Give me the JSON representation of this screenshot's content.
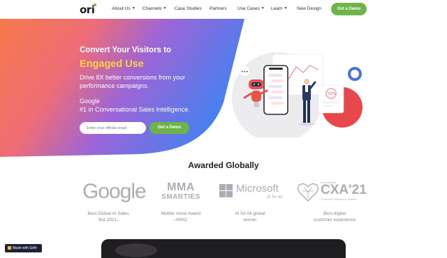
{
  "nav": {
    "logo": "ori",
    "items": [
      {
        "label": "About Us",
        "dropdown": true
      },
      {
        "label": "Channels",
        "dropdown": true
      },
      {
        "label": "Case Studies",
        "dropdown": false
      },
      {
        "label": "Partners",
        "dropdown": false
      },
      {
        "label": "Use Cases",
        "dropdown": true
      },
      {
        "label": "Learn",
        "dropdown": true
      },
      {
        "label": "New Design",
        "dropdown": false
      }
    ],
    "cta_label": "Get a Demo"
  },
  "hero": {
    "title": "Convert Your Visitors to",
    "highlight": "Engaged Use",
    "subtitle": "Drive 8X better conversions from your performance campaigns.",
    "google_line1": "Google",
    "google_line2": "#1 in Conversational Sales Intelligence.",
    "email_placeholder": "Enter your official email",
    "cta_label": "Get a Demo",
    "illustration_percent": "72%"
  },
  "awards": {
    "heading": "Awarded Globally",
    "items": [
      {
        "logo": "Google",
        "caption_lines": [
          "Best Global AI Sales",
          "Bot 2021."
        ]
      },
      {
        "logo_top": "MMA",
        "logo_bottom": "SMARTIES",
        "caption_lines": [
          "Mobile Voice Award",
          "-APAC"
        ]
      },
      {
        "logo": "Microsoft",
        "logo_sub": "AI for all",
        "caption_lines": [
          "AI for All global",
          "winner"
        ]
      },
      {
        "logo": "CXA'21",
        "logo_tag": "International",
        "logo_sub": "Customer Experience Awards",
        "caption_lines": [
          "Best digital",
          "customer experience"
        ]
      }
    ]
  },
  "badge": {
    "label": "Made with Softr"
  },
  "colors": {
    "brand_green": "#6db54a",
    "highlight_yellow": "#ffd23a",
    "gradient_orange": "#f6794b",
    "gradient_purple": "#7c5ce0",
    "gradient_blue": "#4a7ff0"
  }
}
